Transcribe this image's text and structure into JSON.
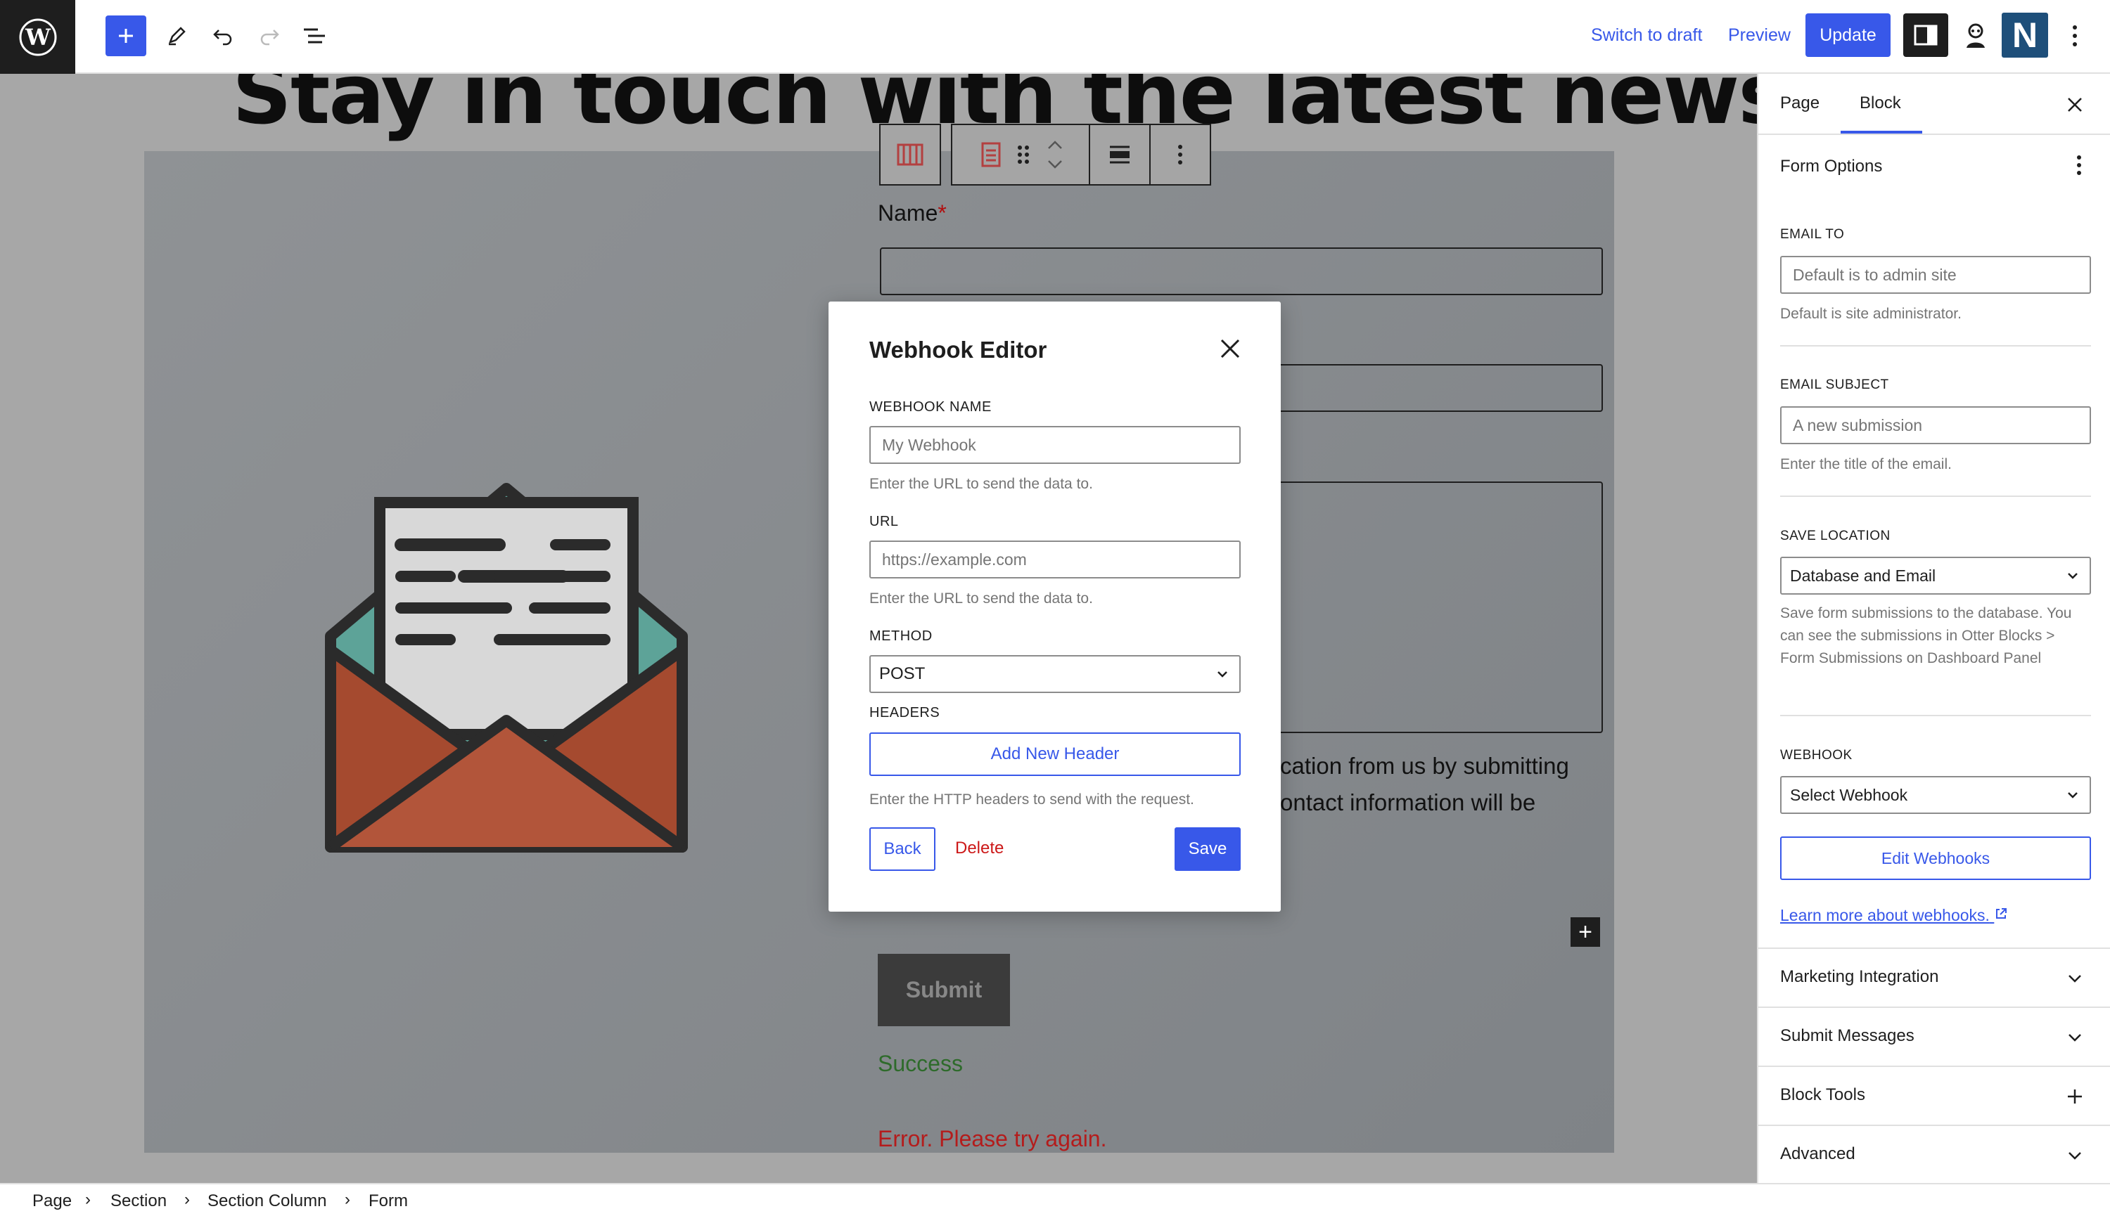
{
  "topbar": {
    "switch_to_draft": "Switch to draft",
    "preview": "Preview",
    "update": "Update",
    "accent": "#3858e9"
  },
  "canvas": {
    "headline": "Stay in touch with the latest news!",
    "name_label": "Name",
    "required_mark": "*",
    "consent_line1": "cation from us by submitting",
    "consent_line2": "ontact information will be",
    "submit": "Submit",
    "success": "Success",
    "error": "Error. Please try again."
  },
  "modal": {
    "title": "Webhook Editor",
    "webhook_name_label": "WEBHOOK NAME",
    "webhook_name_placeholder": "My Webhook",
    "webhook_name_help": "Enter the URL to send the data to.",
    "url_label": "URL",
    "url_placeholder": "https://example.com",
    "url_help": "Enter the URL to send the data to.",
    "method_label": "METHOD",
    "method_value": "POST",
    "headers_label": "HEADERS",
    "add_header": "Add New Header",
    "headers_help": "Enter the HTTP headers to send with the request.",
    "back": "Back",
    "delete": "Delete",
    "save": "Save"
  },
  "sidebar": {
    "tab_page": "Page",
    "tab_block": "Block",
    "form_options": "Form Options",
    "email_to_label": "EMAIL TO",
    "email_to_placeholder": "Default is to admin site",
    "email_to_help": "Default is site administrator.",
    "email_subject_label": "EMAIL SUBJECT",
    "email_subject_placeholder": "A new submission",
    "email_subject_help": "Enter the title of the email.",
    "save_location_label": "SAVE LOCATION",
    "save_location_value": "Database and Email",
    "save_location_help": "Save form submissions to the database. You can see the submissions in Otter Blocks > Form Submissions on Dashboard Panel",
    "webhook_label": "WEBHOOK",
    "webhook_value": "Select Webhook",
    "edit_webhooks": "Edit Webhooks",
    "learn_more": "Learn more about webhooks.",
    "panels": [
      "Marketing Integration",
      "Submit Messages",
      "Block Tools",
      "Advanced"
    ]
  },
  "breadcrumb": [
    "Page",
    "Section",
    "Section Column",
    "Form"
  ]
}
